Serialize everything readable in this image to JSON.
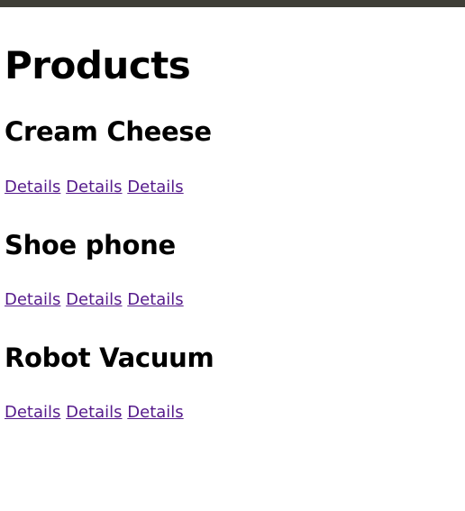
{
  "colors": {
    "topbar": "#3f3e37",
    "link_visited": "#551a8b",
    "text": "#000000"
  },
  "page": {
    "title": "Products"
  },
  "products": [
    {
      "name": "Cream Cheese",
      "links": [
        "Details",
        "Details",
        "Details"
      ]
    },
    {
      "name": "Shoe phone",
      "links": [
        "Details",
        "Details",
        "Details"
      ]
    },
    {
      "name": "Robot Vacuum",
      "links": [
        "Details",
        "Details",
        "Details"
      ]
    }
  ]
}
